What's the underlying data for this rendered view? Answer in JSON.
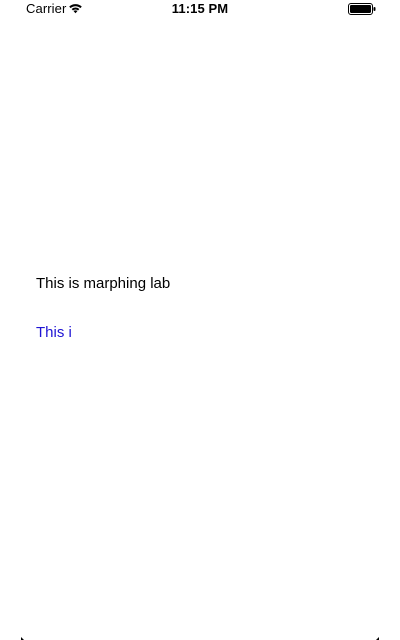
{
  "status_bar": {
    "carrier": "Carrier",
    "time": "11:15 PM",
    "wifi_icon": "wifi-icon",
    "battery_icon": "battery-icon"
  },
  "main": {
    "primary_label": "This is marphing lab",
    "morph_label": "This i",
    "morph_label_color": "#1f14d4"
  }
}
